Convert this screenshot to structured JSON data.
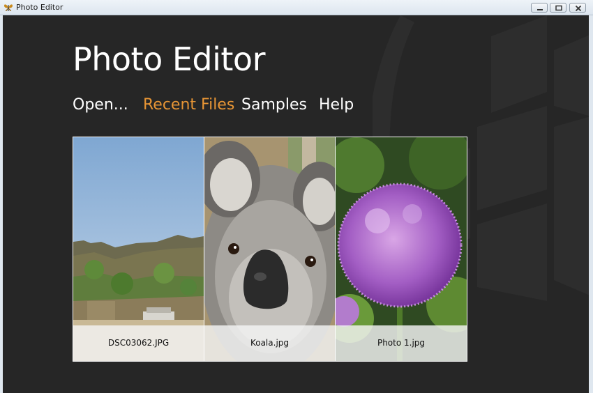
{
  "window": {
    "title": "Photo Editor",
    "app_icon": "butterfly-icon"
  },
  "header": {
    "title": "Photo Editor"
  },
  "nav": [
    {
      "label": "Open...",
      "active": false
    },
    {
      "label": "Recent Files",
      "active": true
    },
    {
      "label": "Samples",
      "active": false
    },
    {
      "label": "Help",
      "active": false
    }
  ],
  "recent_files": [
    {
      "name": "DSC03062.JPG"
    },
    {
      "name": "Koala.jpg"
    },
    {
      "name": "Photo 1.jpg"
    }
  ],
  "colors": {
    "background": "#262626",
    "accent": "#e79535",
    "text": "#ffffff"
  }
}
